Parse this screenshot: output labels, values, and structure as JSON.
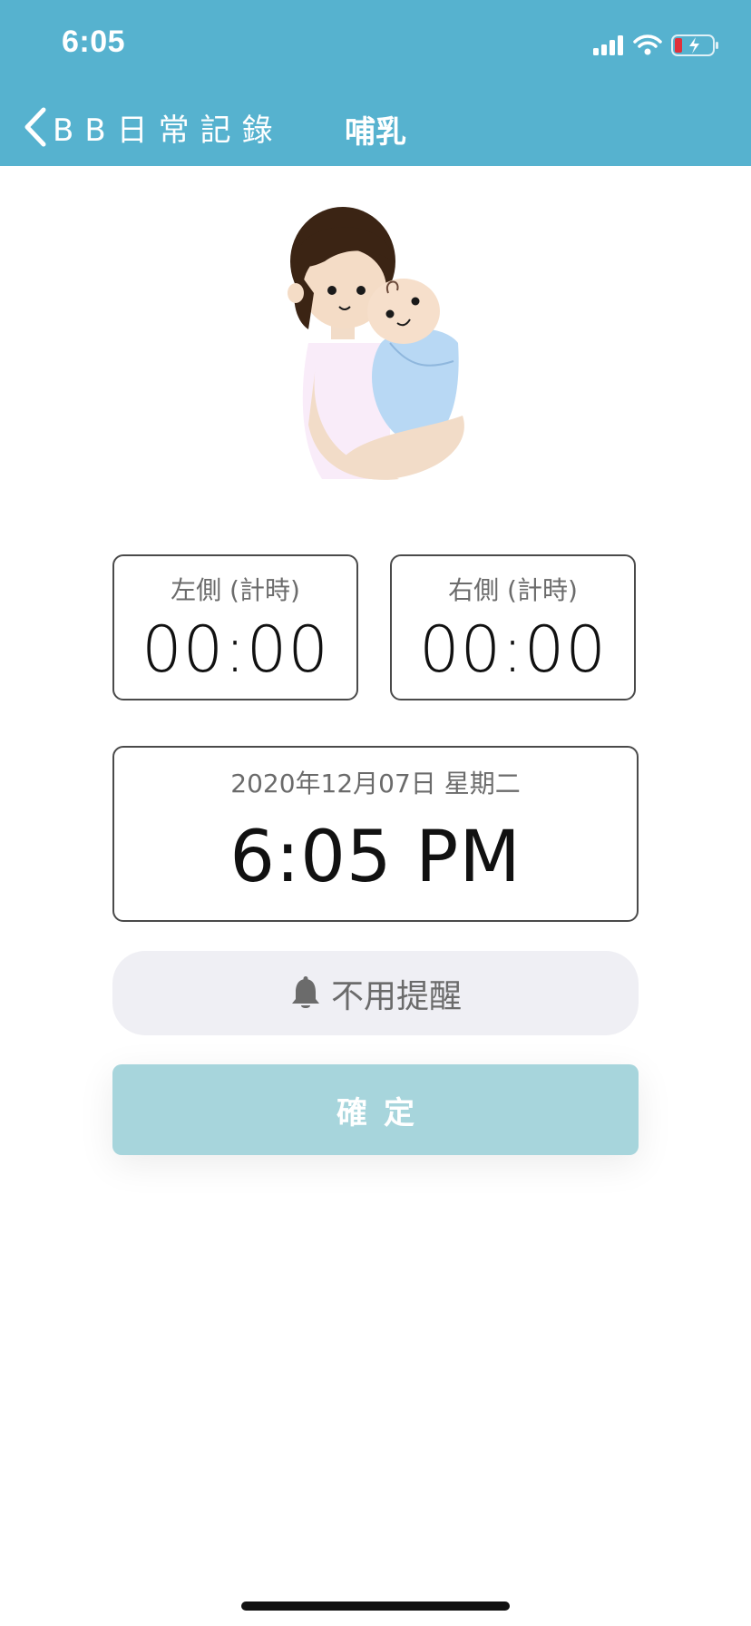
{
  "status_bar": {
    "time": "6:05"
  },
  "nav": {
    "back_label": "BB日常記錄",
    "title": "哺乳"
  },
  "timers": {
    "left": {
      "label": "左側 (計時)",
      "value": "00:00"
    },
    "right": {
      "label": "右側 (計時)",
      "value": "00:00"
    }
  },
  "datetime": {
    "date": "2020年12月07日 星期二",
    "time": "6:05 PM"
  },
  "reminder": {
    "label": "不用提醒"
  },
  "confirm": {
    "label": "確定"
  },
  "colors": {
    "accent": "#56b2cf",
    "confirm": "#a7d5dc",
    "reminder_bg": "#efeff4"
  }
}
